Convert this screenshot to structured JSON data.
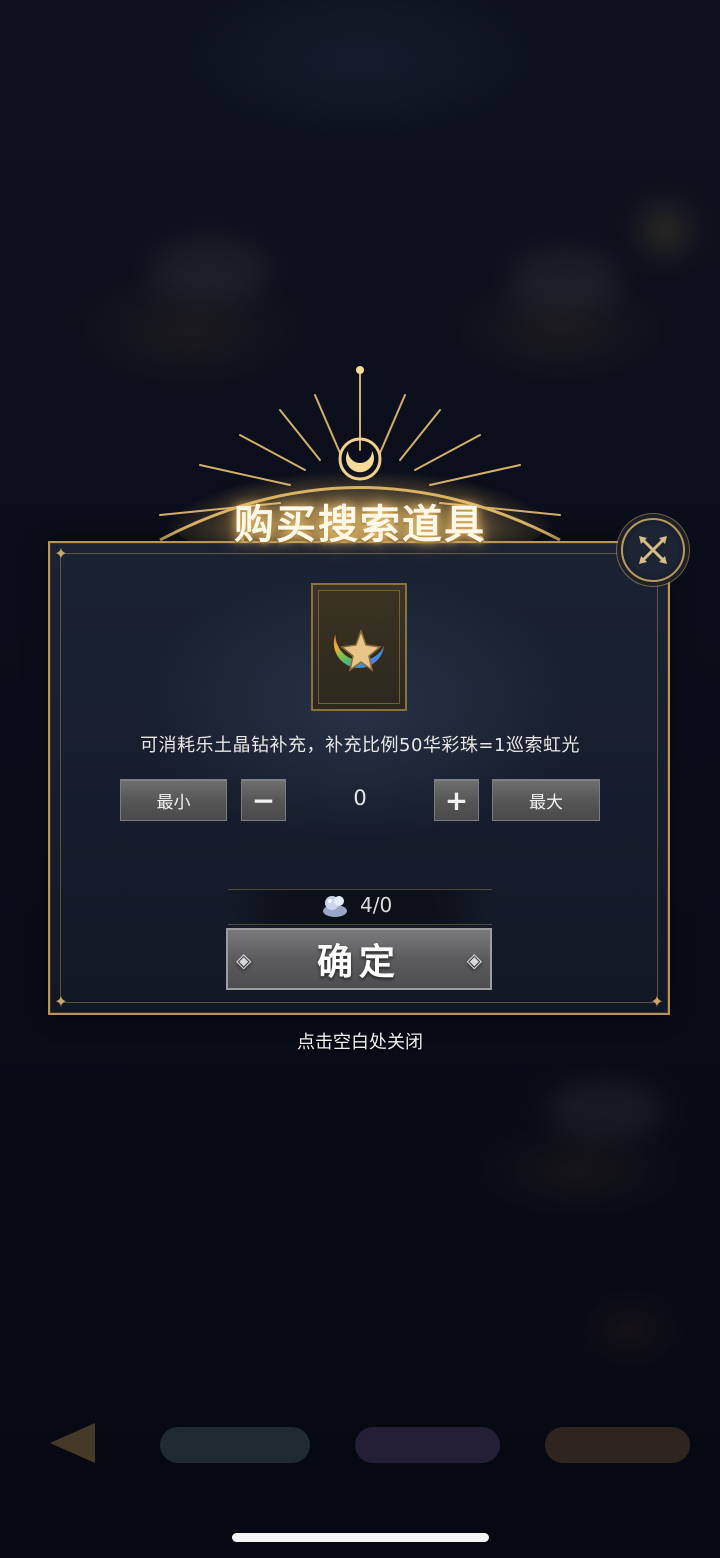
{
  "dialog": {
    "title": "购买搜索道具",
    "description": "可消耗乐土晶钻补充，补充比例50华彩珠=1巡索虹光",
    "item_icon": "rainbow-star-crescent-icon",
    "close_icon": "close-x-icon"
  },
  "quantity": {
    "min_label": "最小",
    "minus_icon": "minus-icon",
    "value": "0",
    "plus_icon": "plus-icon",
    "max_label": "最大"
  },
  "cost": {
    "icon": "gem-icon",
    "text": "4/0"
  },
  "confirm_label": "确定",
  "close_hint": "点击空白处关闭",
  "colors": {
    "gold_accent": "#b5955a",
    "panel_bg": "#161c2b",
    "button_gray": "#5c5c5e"
  }
}
